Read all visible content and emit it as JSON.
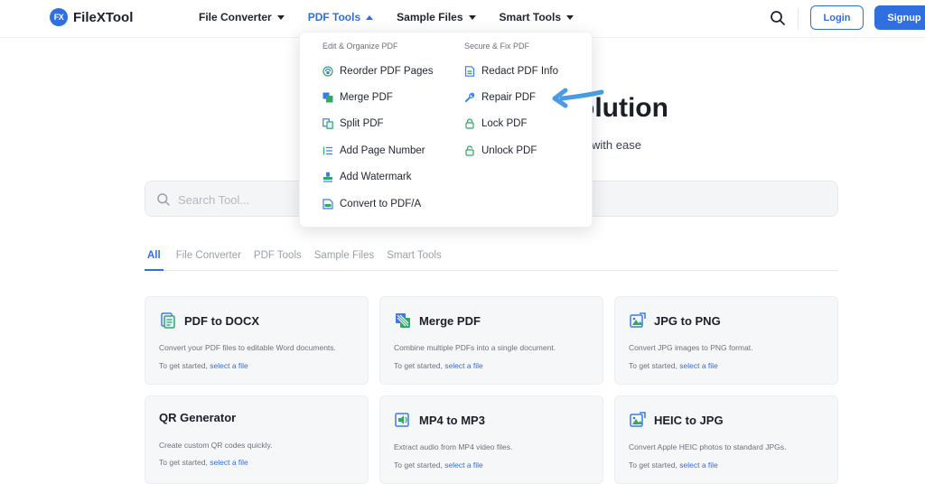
{
  "header": {
    "logo_mark": "FX",
    "logo_text": "FileXTool",
    "nav": [
      {
        "label": "File Converter"
      },
      {
        "label": "PDF Tools"
      },
      {
        "label": "Sample Files"
      },
      {
        "label": "Smart Tools"
      }
    ],
    "login_label": "Login",
    "signup_label": "Signup"
  },
  "hero": {
    "title_visible": "olution",
    "subtitle_visible": "with ease"
  },
  "search": {
    "placeholder": "Search Tool..."
  },
  "tabs": [
    "All",
    "File Converter",
    "PDF Tools",
    "Sample Files",
    "Smart Tools"
  ],
  "cards": [
    {
      "title": "PDF to DOCX",
      "desc": "Convert your PDF files to editable Word documents.",
      "cta_prefix": "To get started,",
      "cta_link": "select a file",
      "icon": "docx-icon"
    },
    {
      "title": "Merge PDF",
      "desc": "Combine multiple PDFs into a single document.",
      "cta_prefix": "To get started,",
      "cta_link": "select a file",
      "icon": "merge-icon"
    },
    {
      "title": "JPG to PNG",
      "desc": "Convert JPG images to PNG format.",
      "cta_prefix": "To get started,",
      "cta_link": "select a file",
      "icon": "image-icon"
    },
    {
      "title": "QR Generator",
      "desc": "Create custom QR codes quickly.",
      "cta_prefix": "To get started,",
      "cta_link": "select a file",
      "icon": ""
    },
    {
      "title": "MP4 to MP3",
      "desc": "Extract audio from MP4 video files.",
      "cta_prefix": "To get started,",
      "cta_link": "select a file",
      "icon": "audio-icon"
    },
    {
      "title": "HEIC to JPG",
      "desc": "Convert Apple HEIC photos to standard JPGs.",
      "cta_prefix": "To get started,",
      "cta_link": "select a file",
      "icon": "image-icon"
    }
  ],
  "dropdown": {
    "left_heading": "Edit & Organize PDF",
    "left_items": [
      {
        "label": "Reorder PDF Pages",
        "icon": "reorder-icon"
      },
      {
        "label": "Merge PDF",
        "icon": "merge-icon"
      },
      {
        "label": "Split PDF",
        "icon": "split-icon"
      },
      {
        "label": "Add Page Number",
        "icon": "list-number-icon"
      },
      {
        "label": "Add Watermark",
        "icon": "stamp-icon"
      },
      {
        "label": "Convert to PDF/A",
        "icon": "pdfa-icon"
      }
    ],
    "right_heading": "Secure & Fix PDF",
    "right_items": [
      {
        "label": "Redact PDF Info",
        "icon": "redact-icon"
      },
      {
        "label": "Repair PDF",
        "icon": "wrench-icon"
      },
      {
        "label": "Lock PDF",
        "icon": "lock-icon"
      },
      {
        "label": "Unlock PDF",
        "icon": "unlock-icon"
      }
    ]
  },
  "colors": {
    "accent": "#2f6fe0",
    "icon_green": "#2fa868",
    "icon_blue": "#3a7be8",
    "annotation_arrow": "#4a9be0"
  }
}
